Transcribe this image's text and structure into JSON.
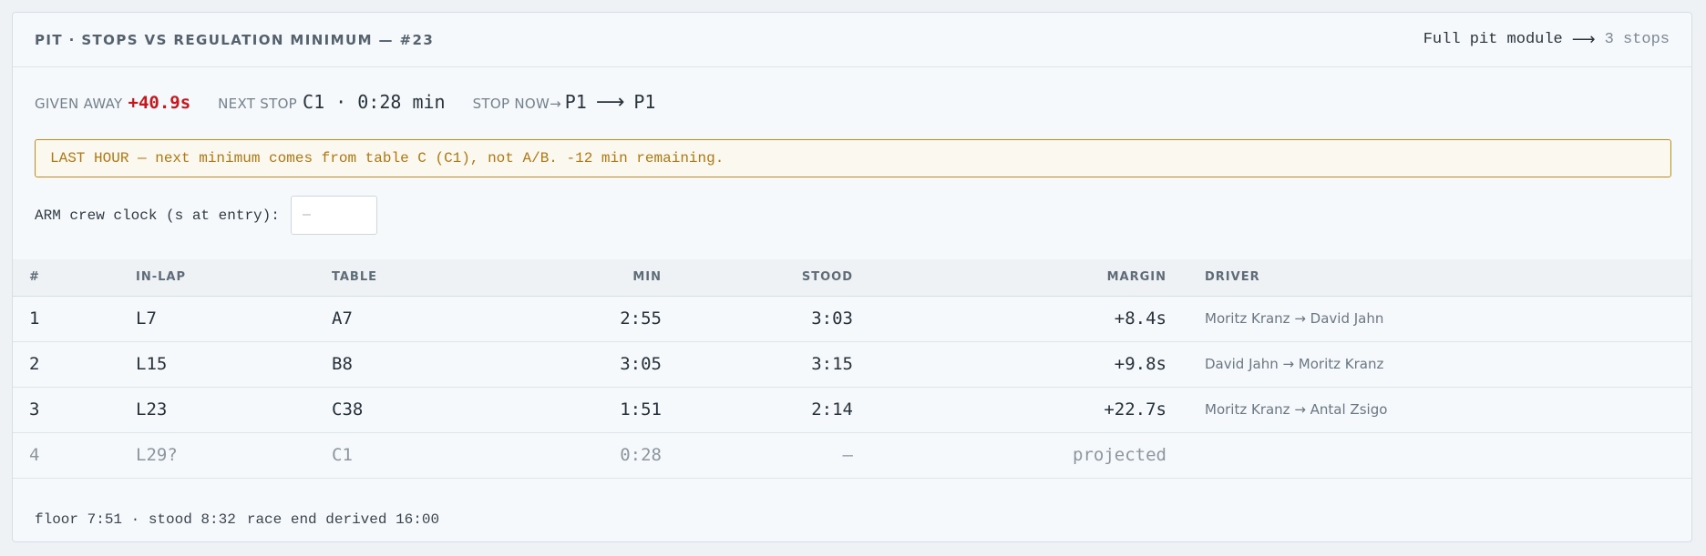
{
  "header": {
    "title": "PIT · STOPS VS REGULATION MINIMUM — #23",
    "link_label": "Full pit module",
    "link_arrow": "⟶",
    "stops_count": "3 stops"
  },
  "metrics": {
    "given_away_label": "GIVEN AWAY",
    "given_away_value": "+40.9s",
    "next_stop_label": "NEXT STOP",
    "next_stop_value": "C1 · 0:28 min",
    "stop_now_label": "STOP NOW",
    "stop_now_arrow": "→",
    "stop_now_from": "P1",
    "stop_now_to_arrow": "⟶",
    "stop_now_to": "P1"
  },
  "warning": {
    "text": "LAST HOUR — next minimum comes from table C (C1), not A/B. -12 min remaining."
  },
  "arm": {
    "label": "ARM crew clock (s at entry):",
    "placeholder": "—",
    "value": ""
  },
  "table": {
    "columns": {
      "num": "#",
      "inlap": "IN-LAP",
      "table": "TABLE",
      "min": "MIN",
      "stood": "STOOD",
      "margin": "MARGIN",
      "driver": "DRIVER"
    },
    "rows": [
      {
        "num": "1",
        "inlap": "L7",
        "table": "A7",
        "min": "2:55",
        "stood": "3:03",
        "margin": "+8.4s",
        "driver": "Moritz Kranz → David Jahn"
      },
      {
        "num": "2",
        "inlap": "L15",
        "table": "B8",
        "min": "3:05",
        "stood": "3:15",
        "margin": "+9.8s",
        "driver": "David Jahn → Moritz Kranz"
      },
      {
        "num": "3",
        "inlap": "L23",
        "table": "C38",
        "min": "1:51",
        "stood": "2:14",
        "margin": "+22.7s",
        "driver": "Moritz Kranz → Antal Zsigo"
      },
      {
        "num": "4",
        "inlap": "L29?",
        "table": "C1",
        "min": "0:28",
        "stood": "—",
        "margin": "projected",
        "driver": ""
      }
    ]
  },
  "footer": {
    "floor_stood": "floor 7:51 · stood 8:32",
    "race_end": "race end derived 16:00"
  },
  "colors": {
    "accent_red": "#c8161d",
    "warning_amber": "#b07813"
  }
}
